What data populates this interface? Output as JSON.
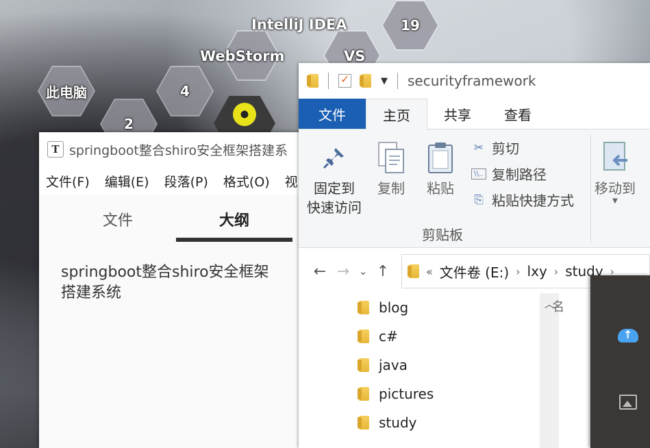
{
  "desktop": {
    "hexes": [
      {
        "name": "hex-this-pc",
        "label": "此电脑"
      },
      {
        "name": "hex-count-4",
        "label": "4"
      },
      {
        "name": "hex-count-19",
        "label": "19"
      },
      {
        "name": "hex-count-2",
        "label": "2"
      }
    ],
    "labels": {
      "intellij": "IntelliJ IDEA",
      "webstorm": "WebStorm",
      "vs": "VS"
    }
  },
  "typora": {
    "icon_letter": "T",
    "title": "springboot整合shiro安全框架搭建系",
    "menu": [
      "文件(F)",
      "编辑(E)",
      "段落(P)",
      "格式(O)",
      "视"
    ],
    "tabs": [
      "文件",
      "大纲"
    ],
    "active_tab": "大纲",
    "outline_text": "springboot整合shiro安全框架搭建系统"
  },
  "explorer": {
    "title": "securityframework",
    "ribbon_tabs": [
      "文件",
      "主页",
      "共享",
      "查看"
    ],
    "active_ribbon_tab": "主页",
    "clipboard": {
      "pin_line1": "固定到",
      "pin_line2": "快速访问",
      "copy": "复制",
      "paste": "粘贴",
      "cut": "剪切",
      "copy_path": "复制路径",
      "paste_shortcut": "粘贴快捷方式",
      "group_label": "剪贴板"
    },
    "organize": {
      "move_to": "移动到"
    },
    "address": {
      "overflow": "«",
      "crumbs": [
        "文件卷 (E:)",
        "lxy",
        "study"
      ]
    },
    "tree_items": [
      "blog",
      "c#",
      "java",
      "pictures",
      "study"
    ],
    "right_pane_text": "名"
  },
  "colors": {
    "file_tab_bg": "#1a5fb4",
    "cloud_icon": "#4aa3f0",
    "dark_panel_bg": "#3a3735"
  }
}
